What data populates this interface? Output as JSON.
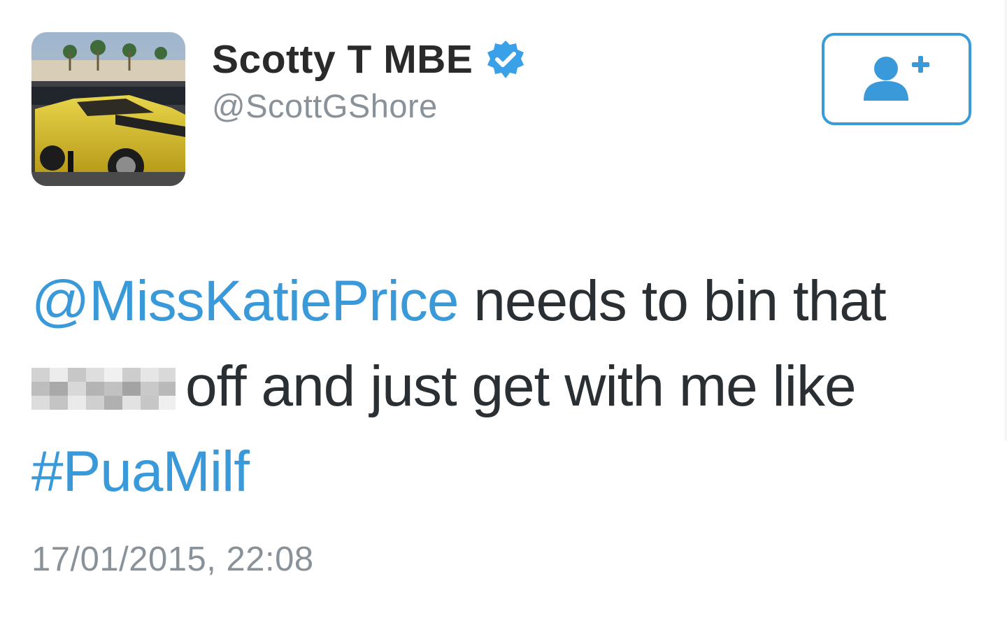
{
  "user": {
    "display_name": "Scotty T MBE",
    "handle": "@ScottGShore",
    "verified": true,
    "avatar_icon": "profile-photo-yellow-convertible"
  },
  "follow_button": {
    "icon": "add-user-icon"
  },
  "tweet": {
    "line1_mention": "@MissKatiePrice",
    "line1_text": " needs to bin that",
    "line2_text": "off and just get with me like",
    "line3_hashtag": "#PuaMilf",
    "timestamp": "17/01/2015, 22:08"
  },
  "colors": {
    "link_blue": "#3a9ad9",
    "button_border": "#3b9bd8",
    "verified_badge": "#3aa0e8",
    "text_dark": "#292f33",
    "text_muted": "#8a9299"
  }
}
